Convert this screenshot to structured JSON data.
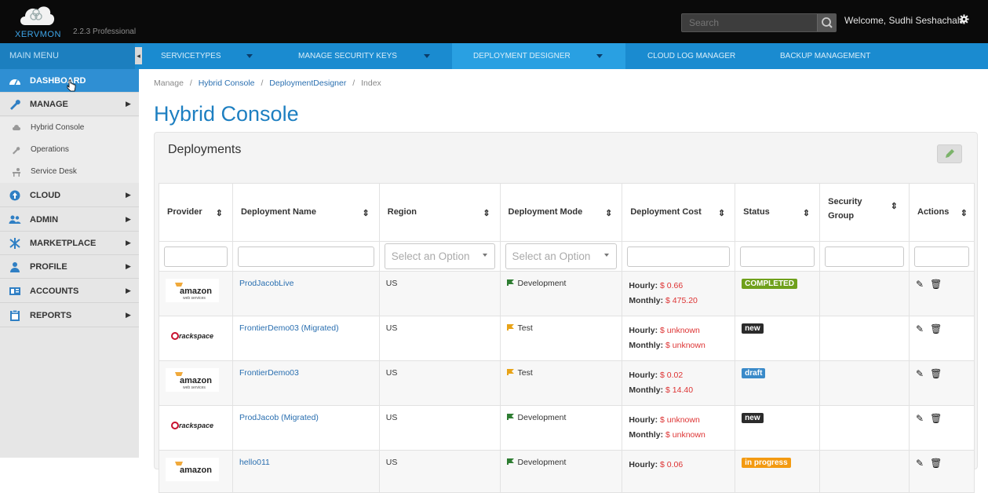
{
  "brand": {
    "name": "XERVMON",
    "version": "2.2.3 Professional"
  },
  "header": {
    "search_placeholder": "Search",
    "welcome": "Welcome, Sudhi Seshachala"
  },
  "menubar": {
    "main_menu": "MAIN MENU",
    "items": [
      {
        "label": "SERVICETYPES"
      },
      {
        "label": "MANAGE SECURITY KEYS"
      },
      {
        "label": "DEPLOYMENT DESIGNER"
      },
      {
        "label": "CLOUD LOG MANAGER"
      },
      {
        "label": "BACKUP MANAGEMENT"
      }
    ]
  },
  "sidebar": {
    "items": [
      {
        "label": "DASHBOARD",
        "icon": "dashboard-icon"
      },
      {
        "label": "MANAGE",
        "icon": "wrench-icon"
      },
      {
        "label": "Hybrid Console",
        "icon": "cloud-icon"
      },
      {
        "label": "Operations",
        "icon": "wrench-icon"
      },
      {
        "label": "Service Desk",
        "icon": "desk-icon"
      },
      {
        "label": "CLOUD",
        "icon": "cloud-upload-icon"
      },
      {
        "label": "ADMIN",
        "icon": "users-icon"
      },
      {
        "label": "MARKETPLACE",
        "icon": "network-icon"
      },
      {
        "label": "PROFILE",
        "icon": "user-icon"
      },
      {
        "label": "ACCOUNTS",
        "icon": "accounts-icon"
      },
      {
        "label": "REPORTS",
        "icon": "clipboard-icon"
      }
    ]
  },
  "breadcrumb": {
    "manage": "Manage",
    "hybrid": "Hybrid Console",
    "designer": "DeploymentDesigner",
    "index": "Index",
    "sep": "/"
  },
  "page": {
    "title": "Hybrid Console",
    "panel_title": "Deployments"
  },
  "table": {
    "columns": [
      "Provider",
      "Deployment Name",
      "Region",
      "Deployment Mode",
      "Deployment Cost",
      "Status",
      "Security Group",
      "Actions"
    ],
    "filters": {
      "region": "Select an Option",
      "mode": "Select an Option"
    },
    "cost_labels": {
      "hourly": "Hourly:",
      "monthly": "Monthly:"
    },
    "rows": [
      {
        "provider": "amazon",
        "provider_label": "amazon",
        "provider_sub": "web services",
        "name": "ProdJacobLive",
        "region": "US",
        "mode": "Development",
        "hourly": "$ 0.66",
        "monthly": "$ 475.20",
        "status": "COMPLETED",
        "status_color": "#6fa01b"
      },
      {
        "provider": "rackspace",
        "provider_label": "rackspace",
        "provider_sub": "",
        "name": "FrontierDemo03 (Migrated)",
        "region": "US",
        "mode": "Test",
        "hourly": "$ unknown",
        "monthly": "$ unknown",
        "status": "new",
        "status_color": "#2b2b2b"
      },
      {
        "provider": "amazon",
        "provider_label": "amazon",
        "provider_sub": "web services",
        "name": "FrontierDemo03",
        "region": "US",
        "mode": "Test",
        "hourly": "$ 0.02",
        "monthly": "$ 14.40",
        "status": "draft",
        "status_color": "#3a8ac9"
      },
      {
        "provider": "rackspace",
        "provider_label": "rackspace",
        "provider_sub": "",
        "name": "ProdJacob (Migrated)",
        "region": "US",
        "mode": "Development",
        "hourly": "$ unknown",
        "monthly": "$ unknown",
        "status": "new",
        "status_color": "#2b2b2b"
      },
      {
        "provider": "amazon",
        "provider_label": "amazon",
        "provider_sub": "",
        "name": "hello011",
        "region": "US",
        "mode": "Development",
        "hourly": "$ 0.06",
        "monthly": "",
        "status": "in progress",
        "status_color": "#f39a11"
      }
    ]
  }
}
